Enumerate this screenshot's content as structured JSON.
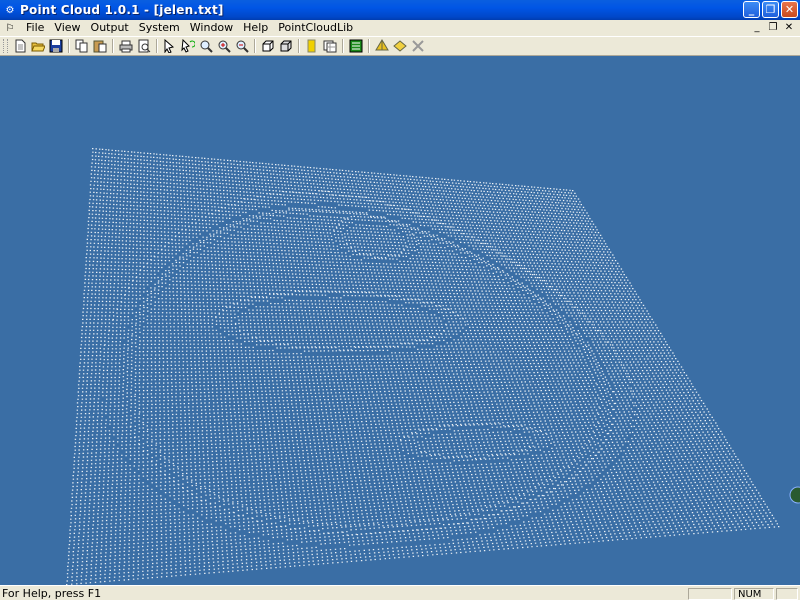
{
  "window": {
    "title": "Point Cloud 1.0.1 - [jelen.txt]",
    "app_icon": "point-cloud-app-icon"
  },
  "menu": {
    "items": [
      "File",
      "View",
      "Output",
      "System",
      "Window",
      "Help",
      "PointCloudLib"
    ]
  },
  "toolbar": {
    "buttons": [
      {
        "icon": "new-icon"
      },
      {
        "icon": "open-icon"
      },
      {
        "icon": "save-icon"
      },
      {
        "icon": "copy-icon"
      },
      {
        "icon": "paste-icon"
      },
      {
        "icon": "print-icon"
      },
      {
        "icon": "print-preview-icon"
      },
      {
        "icon": "select-icon"
      },
      {
        "icon": "rotate-icon"
      },
      {
        "icon": "zoom-icon"
      },
      {
        "icon": "zoom-in-icon"
      },
      {
        "icon": "zoom-extents-icon"
      },
      {
        "icon": "box-view-icon"
      },
      {
        "icon": "box-wire-icon"
      },
      {
        "icon": "highlight-icon"
      },
      {
        "icon": "grid-icon"
      },
      {
        "icon": "export-icon"
      },
      {
        "icon": "shade-icon"
      },
      {
        "icon": "surface-icon"
      },
      {
        "icon": "delete-icon"
      }
    ]
  },
  "viewport": {
    "background": "#3a6ea5",
    "point_color": "#ffffff"
  },
  "statusbar": {
    "help_text": "For Help, press F1",
    "num_indicator": "NUM"
  }
}
